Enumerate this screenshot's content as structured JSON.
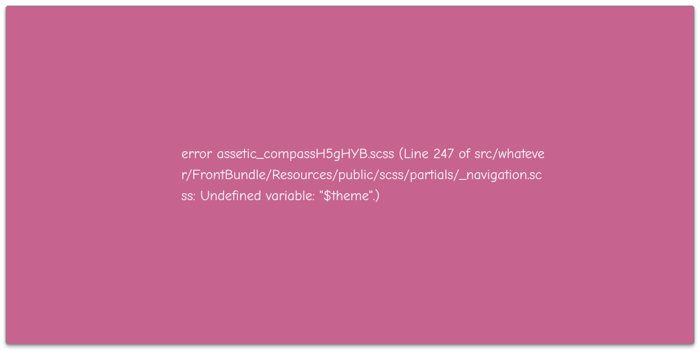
{
  "error": {
    "message": "error assetic_compassH5gHYB.scss (Line 247 of src/whatever/FrontBundle/Resources/public/scss/partials/_navigation.scss: Undefined variable: \"$theme\".)"
  },
  "colors": {
    "panel_bg": "#c7638f",
    "text": "#ffffff"
  }
}
